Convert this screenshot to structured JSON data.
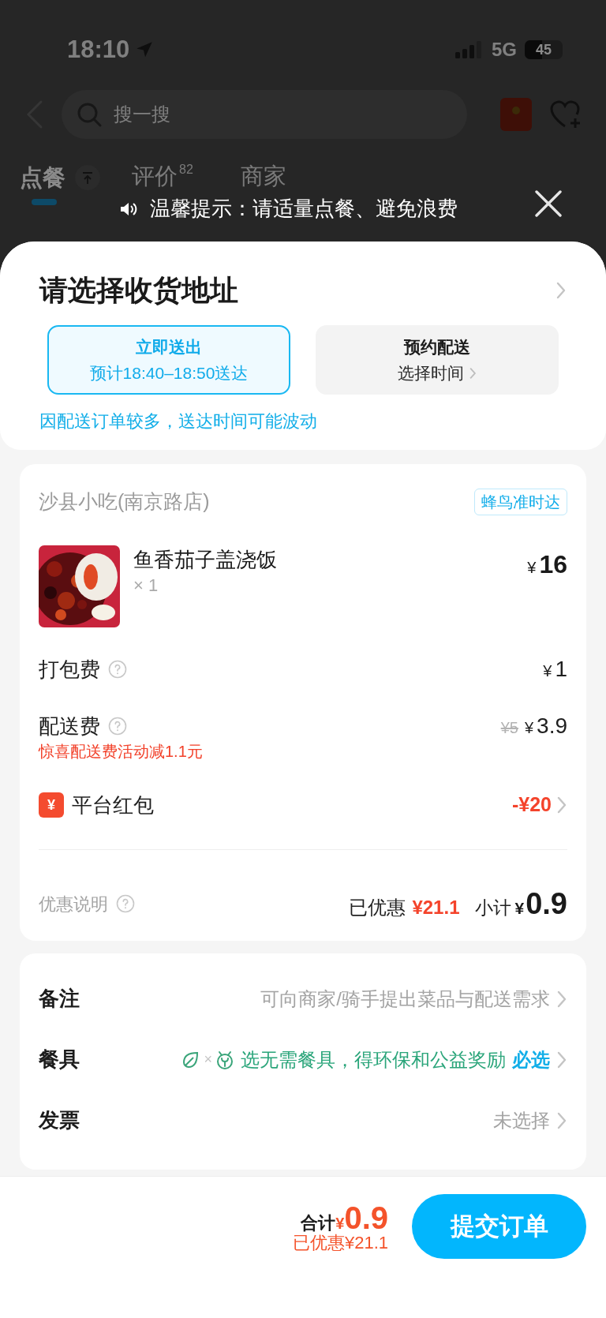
{
  "status_bar": {
    "time": "18:10",
    "network": "5G",
    "battery": "45"
  },
  "header": {
    "search_placeholder": "搜一搜"
  },
  "tabs": [
    {
      "label": "点餐",
      "selected": true
    },
    {
      "label": "评价",
      "badge": "82",
      "selected": false
    },
    {
      "label": "商家",
      "selected": false
    }
  ],
  "notice": {
    "text": "温馨提示：请适量点餐、避免浪费"
  },
  "address": {
    "title": "请选择收货地址"
  },
  "delivery_options": [
    {
      "title": "立即送出",
      "subtitle": "预计18:40–18:50送达",
      "selected": true
    },
    {
      "title": "预约配送",
      "subtitle": "选择时间",
      "selected": false
    }
  ],
  "delivery_note": "因配送订单较多，送达时间可能波动",
  "order": {
    "store": "沙县小吃(南京路店)",
    "tag": "蜂鸟准时达",
    "items": [
      {
        "name": "鱼香茄子盖浇饭",
        "quantity": "× 1",
        "currency": "¥",
        "price": "16"
      }
    ],
    "fees": [
      {
        "kind": "fee",
        "label": "打包费",
        "currency": "¥",
        "amount": "1"
      },
      {
        "kind": "fee",
        "label": "配送费",
        "original": "¥5",
        "currency": "¥",
        "amount": "3.9",
        "note": "惊喜配送费活动减1.1元"
      },
      {
        "kind": "coupon",
        "label": "平台红包",
        "icon": "¥",
        "amount": "-¥20"
      }
    ],
    "summary": {
      "label": "优惠说明",
      "saved_label": "已优惠",
      "saved": "¥21.1",
      "subtotal_label": "小计",
      "currency": "¥",
      "subtotal": "0.9"
    }
  },
  "options": [
    {
      "kind": "text",
      "label": "备注",
      "value": "可向商家/骑手提出菜品与配送需求"
    },
    {
      "kind": "eco",
      "label": "餐具",
      "separator": "×",
      "value": "选无需餐具，得环保和公益奖励",
      "badge": "必选"
    },
    {
      "kind": "text",
      "label": "发票",
      "value": "未选择"
    }
  ],
  "footer": {
    "total_label": "合计",
    "currency": "¥",
    "total": "0.9",
    "saved": "已优惠¥21.1",
    "submit": "提交订单"
  }
}
